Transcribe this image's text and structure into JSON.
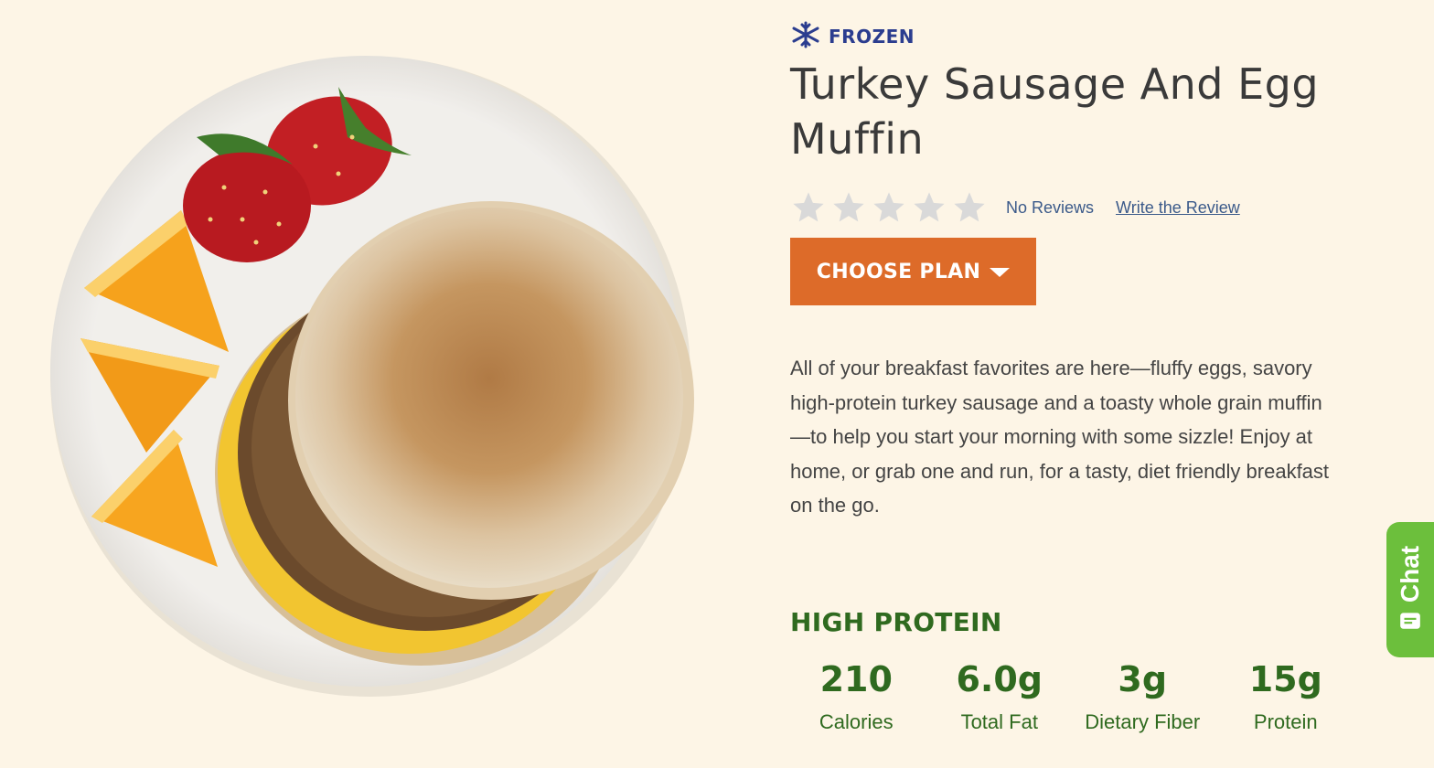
{
  "badge": {
    "icon": "snowflake-icon",
    "label": "FROZEN",
    "color": "#2b3d8f"
  },
  "product": {
    "title": "Turkey Sausage And Egg Muffin",
    "description": "All of your breakfast favorites are here—fluffy eggs, savory high-protein turkey sausage and a toasty whole grain muffin—to help you start your morning with some sizzle! Enjoy at home, or grab one and run, for a tasty, diet friendly breakfast on the go."
  },
  "rating": {
    "stars_filled": 0,
    "stars_total": 5,
    "reviews_text": "No Reviews",
    "write_review_label": "Write the Review"
  },
  "plan_button": {
    "label": "CHOOSE PLAN",
    "icon": "caret-down-icon",
    "color": "#dd6b29"
  },
  "nutrition": {
    "heading": "HIGH PROTEIN",
    "items": [
      {
        "value": "210",
        "label": "Calories"
      },
      {
        "value": "6.0g",
        "label": "Total Fat"
      },
      {
        "value": "3g",
        "label": "Dietary Fiber"
      },
      {
        "value": "15g",
        "label": "Protein"
      }
    ],
    "color": "#2f6a1f"
  },
  "chat": {
    "label": "Chat",
    "icon": "chat-bubble-icon",
    "color": "#6cbf3c"
  },
  "colors": {
    "background": "#fdf5e6",
    "link": "#3b5a8a",
    "star_empty": "#d9d9d9"
  }
}
